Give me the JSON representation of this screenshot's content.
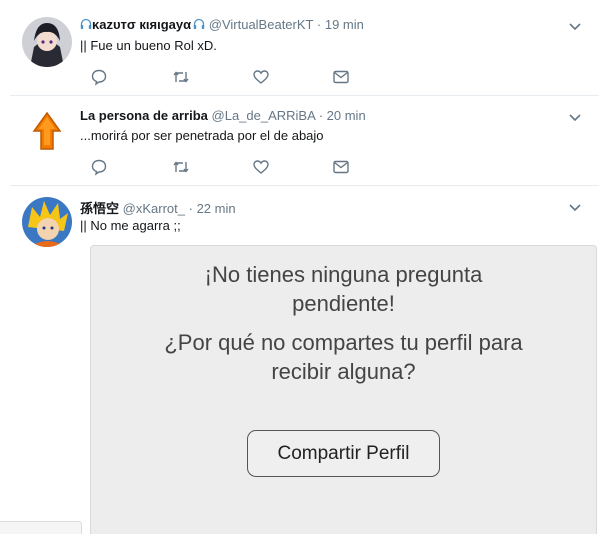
{
  "tweets": [
    {
      "name": "κazυтσ кιяιgayα",
      "handle": "@VirtualBeaterKT",
      "time": "19 min",
      "text": "|| Fue un bueno Rol xD."
    },
    {
      "name": "La persona de arriba",
      "handle": "@La_de_ARRiBA",
      "time": "20 min",
      "text": "...morirá por ser penetrada por el de abajo"
    },
    {
      "name": "孫悟空",
      "handle": "@xKarrot_",
      "time": "22 min",
      "text": "|| No me agarra ;;"
    }
  ],
  "separator": "·",
  "card": {
    "title_line1": "¡No tienes ninguna pregunta",
    "title_line2": "pendiente!",
    "subtitle_line1": "¿Por qué no compartes tu perfil para",
    "subtitle_line2": "recibir alguna?",
    "share_button": "Compartir Perfil"
  },
  "icons": {
    "reply": "reply-icon",
    "retweet": "retweet-icon",
    "like": "heart-icon",
    "dm": "envelope-icon",
    "more": "chevron-down-icon"
  },
  "colors": {
    "text": "#14171a",
    "secondary": "#657786",
    "divider": "#e6ecf0",
    "card_bg": "#ededed",
    "arrow": "#f07d00"
  }
}
